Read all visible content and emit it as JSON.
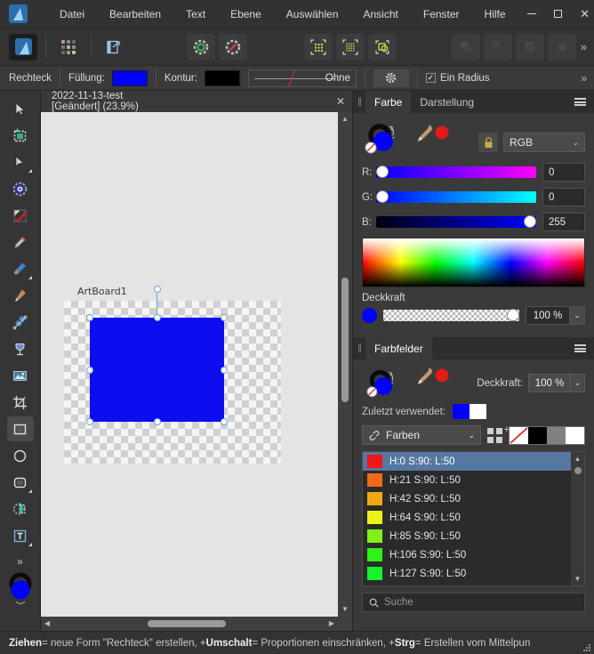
{
  "titlebar": {
    "logo": "affinity-designer-logo",
    "menus": [
      "Datei",
      "Bearbeiten",
      "Text",
      "Ebene",
      "Auswählen",
      "Ansicht",
      "Fenster",
      "Hilfe"
    ],
    "minimize": "minimize-button",
    "maximize": "maximize-button",
    "close": "✕"
  },
  "toolbar": {
    "overflow": "»",
    "buttons": [
      {
        "name": "designer-persona",
        "icon": "app-logo-icon"
      },
      {
        "name": "persona-switch",
        "icon": "dots-grid-icon"
      },
      {
        "name": "export-persona",
        "icon": "export-icon"
      },
      {
        "name": "snapping-enabled",
        "icon": "snapping-icon"
      },
      {
        "name": "snapping-disabled",
        "icon": "snapping-off-icon"
      },
      {
        "name": "show-grid",
        "icon": "grid-sparse-icon"
      },
      {
        "name": "show-pixel-grid",
        "icon": "grid-dense-icon"
      },
      {
        "name": "show-selection-bounds",
        "icon": "bounds-icon"
      },
      {
        "name": "boolean-add",
        "icon": "boolean-add-icon"
      },
      {
        "name": "boolean-subtract",
        "icon": "boolean-subtract-icon"
      },
      {
        "name": "boolean-intersect",
        "icon": "boolean-intersect-icon"
      },
      {
        "name": "boolean-divide",
        "icon": "boolean-divide-icon"
      }
    ]
  },
  "contextbar": {
    "tool_name": "Rechteck",
    "fill_label": "Füllung:",
    "fill_color": "#0000ff",
    "stroke_label": "Kontur:",
    "stroke_color": "#000000",
    "stroke_width_value": "Ohne",
    "settings_icon": "gear-icon",
    "single_radius_label": "Ein Radius",
    "single_radius_checked": true,
    "overflow": "»"
  },
  "tools": [
    {
      "name": "move-tool",
      "icon": "cursor-arrow-icon"
    },
    {
      "name": "artboard-tool",
      "icon": "artboard-icon"
    },
    {
      "name": "node-tool",
      "icon": "node-arrow-icon"
    },
    {
      "name": "corner-tool",
      "icon": "corner-ring-icon"
    },
    {
      "name": "pen-curve-tool",
      "icon": "curve-icon"
    },
    {
      "name": "pen-tool",
      "icon": "pen-nib-icon"
    },
    {
      "name": "paint-brush-tool",
      "icon": "paintbrush-icon"
    },
    {
      "name": "pencil-tool",
      "icon": "pencil-icon"
    },
    {
      "name": "vector-brush-tool",
      "icon": "vector-brush-icon"
    },
    {
      "name": "fill-tool",
      "icon": "fill-goblet-icon"
    },
    {
      "name": "place-image-tool",
      "icon": "image-icon"
    },
    {
      "name": "crop-tool",
      "icon": "crop-icon"
    },
    {
      "name": "rectangle-tool",
      "icon": "rectangle-icon"
    },
    {
      "name": "ellipse-tool",
      "icon": "ellipse-icon"
    },
    {
      "name": "rounded-rectangle-tool",
      "icon": "rounded-rectangle-icon"
    },
    {
      "name": "selection-brush-tool",
      "icon": "selection-brush-icon"
    },
    {
      "name": "text-frame-tool",
      "icon": "text-frame-icon"
    }
  ],
  "tools_overflow": "»",
  "tool_fill_color": "#0000ff",
  "tool_stroke_color": "#000000",
  "document": {
    "tab_title": "2022-11-13-test [Geändert] (23.9%)",
    "close_glyph": "✕",
    "artboard_label": "ArtBoard1",
    "shape_fill": "#0d0df0",
    "handle_color": "#6aa6e0"
  },
  "color_panel": {
    "tabs": [
      {
        "label": "Farbe",
        "active": true
      },
      {
        "label": "Darstellung",
        "active": false
      }
    ],
    "menu_icon": "hamburger-icon",
    "wheel_icon": "color-wheel-icon",
    "dropper_icon": "eyedropper-icon",
    "dropper_sample_color": "#e01b18",
    "lock_icon": "lock-icon",
    "mode": "RGB",
    "mode_chevron": "⌄",
    "channels": [
      {
        "label": "R:",
        "value": "0",
        "knob_pct": 0
      },
      {
        "label": "G:",
        "value": "0",
        "knob_pct": 0
      },
      {
        "label": "B:",
        "value": "255",
        "knob_pct": 100
      }
    ],
    "opacity_label": "Deckkraft",
    "opacity_value": "100 %",
    "opacity_chevron": "⌄",
    "current_color": "#0000ff"
  },
  "swatches_panel": {
    "tab_label": "Farbfelder",
    "menu_icon": "hamburger-icon",
    "wheel_icon": "color-wheel-icon",
    "dropper_icon": "eyedropper-icon",
    "opacity_label": "Deckkraft:",
    "opacity_value": "100 %",
    "opacity_chevron": "⌄",
    "recent_label": "Zuletzt verwendet:",
    "recent_colors": [
      "#0000ff",
      "#ffffff"
    ],
    "palette_name": "Farben",
    "palette_link_icon": "link-icon",
    "palette_chevron": "⌄",
    "add_swatch_icon": "add-swatch-grid-icon",
    "quick_swatches": [
      "none",
      "#000000",
      "#808080",
      "#ffffff"
    ],
    "scroll_up_icon": "▲",
    "scroll_down_icon": "▼",
    "swatches": [
      {
        "label": "H:0 S:90: L:50",
        "color": "#f21616",
        "selected": true
      },
      {
        "label": "H:21 S:90: L:50",
        "color": "#f26a16",
        "selected": false
      },
      {
        "label": "H:42 S:90: L:50",
        "color": "#f2a916",
        "selected": false
      },
      {
        "label": "H:64 S:90: L:50",
        "color": "#edf216",
        "selected": false
      },
      {
        "label": "H:85 S:90: L:50",
        "color": "#7ef216",
        "selected": false
      },
      {
        "label": "H:106 S:90: L:50",
        "color": "#2cf216",
        "selected": false
      },
      {
        "label": "H:127 S:90: L:50",
        "color": "#16f22c",
        "selected": false
      }
    ],
    "search_icon": "search-icon",
    "search_placeholder": "Suche"
  },
  "statusbar": {
    "part1_bold": "Ziehen",
    "part1": " = neue Form \"Rechteck\" erstellen, +",
    "part2_bold": "Umschalt",
    "part2": " = Proportionen einschränken, +",
    "part3_bold": "Strg",
    "part3": " = Erstellen vom Mittelpun"
  }
}
